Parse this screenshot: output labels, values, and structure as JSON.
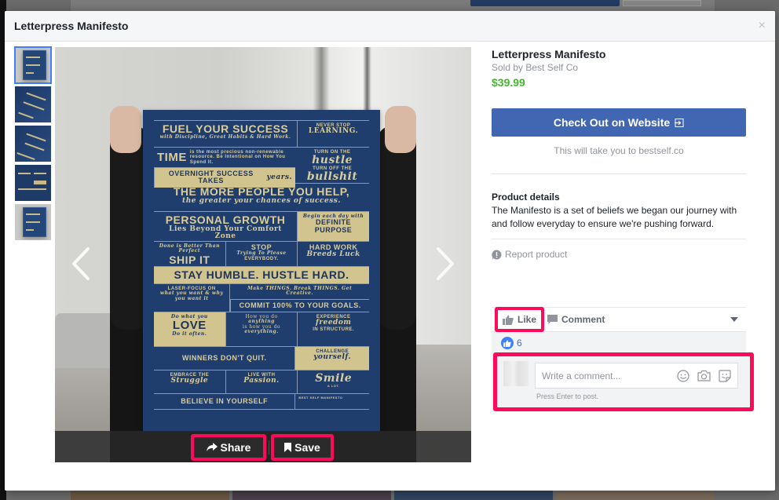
{
  "modal": {
    "title": "Letterpress Manifesto",
    "close_label": "×"
  },
  "thumbnails": [
    {
      "label": "Image 1",
      "active": true
    },
    {
      "label": "Image 2",
      "active": false
    },
    {
      "label": "Image 3",
      "active": false
    },
    {
      "label": "Image 4",
      "active": false
    },
    {
      "label": "Image 5",
      "active": false
    }
  ],
  "poster": {
    "rows": [
      [
        "FUEL YOUR SUCCESS",
        "with Discipline, Great Habits & Hard Work.",
        "NEVER STOP",
        "LEARNING."
      ],
      [
        "TIME",
        "is the most precious non-renewable resource. Be Intentional on How You Spend It.",
        "TURN ON THE",
        "hustle",
        "TURN OFF THE",
        "bullshit"
      ],
      [
        "OVERNIGHT SUCCESS TAKES",
        "years."
      ],
      [
        "THE MORE PEOPLE YOU HELP,",
        "the greater your chances of success."
      ],
      [
        "PERSONAL GROWTH",
        "Lies Beyond Your Comfort Zone",
        "Begin each day with",
        "DEFINITE PURPOSE"
      ],
      [
        "Done is Better Than Perfect",
        "SHIP IT",
        "STOP",
        "Trying To Please",
        "EVERYBODY.",
        "HARD WORK",
        "Breeds Luck"
      ],
      [
        "STAY HUMBLE. HUSTLE HARD."
      ],
      [
        "LASER-FOCUS ON",
        "what you want & why you want it",
        "Make THINGS. Break THINGS. Get Creative.",
        "COMMIT 100% TO YOUR GOALS."
      ],
      [
        "Do what you",
        "LOVE",
        "Do it often.",
        "How you do",
        "anything",
        "is how you do",
        "everything.",
        "EXPERIENCE",
        "freedom",
        "IN STRUCTURE."
      ],
      [
        "WINNERS DON'T QUIT.",
        "CHALLENGE",
        "yourself."
      ],
      [
        "EMBRACE THE",
        "Struggle",
        "LIVE WITH",
        "Passion.",
        "Smile",
        "A LOT."
      ],
      [
        "BELIEVE IN YOURSELF",
        "BEST SELF MANIFESTO"
      ]
    ]
  },
  "viewer": {
    "share_label": "Share",
    "save_label": "Save"
  },
  "product": {
    "title": "Letterpress Manifesto",
    "seller": "Sold by Best Self Co",
    "price": "$39.99",
    "checkout_label": "Check Out on Website",
    "redirect_note": "This will take you to bestself.co",
    "details_title": "Product details",
    "details_body": "The Manifesto is a set of beliefs we began our journey with and follow everyday to ensure we're pushing forward.",
    "report_label": "Report product"
  },
  "ufi": {
    "like_label": "Like",
    "comment_label": "Comment",
    "like_count": "6",
    "comment_placeholder": "Write a comment...",
    "press_enter_hint": "Press Enter to post."
  },
  "colors": {
    "brand_blue": "#4267b2",
    "price_green": "#42b72a",
    "highlight_pink": "#ff0a5a",
    "active_thumb": "#4080ff"
  }
}
